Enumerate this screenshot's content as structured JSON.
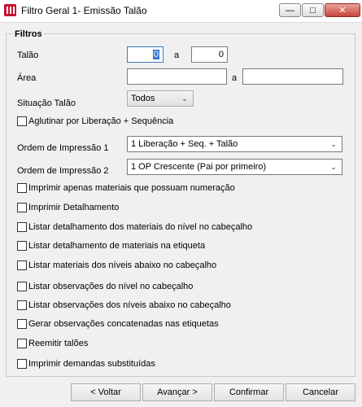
{
  "window": {
    "title": "Filtro Geral 1- Emissão Talão",
    "minimize": "—",
    "maximize": "□",
    "close": "✕"
  },
  "group_title": "Filtros",
  "talao": {
    "label": "Talão",
    "from_value": "0",
    "sep": "a",
    "to_value": "0"
  },
  "area": {
    "label": "Área",
    "from_value": "",
    "sep": "a",
    "to_value": ""
  },
  "situacao": {
    "label": "Situação Talão",
    "value": "Todos"
  },
  "aglutinar": {
    "label": "Aglutinar por Liberação + Sequência",
    "checked": false
  },
  "ordem1": {
    "label": "Ordem de Impressão 1",
    "value": "1 Liberação + Seq. + Talão"
  },
  "ordem2": {
    "label": "Ordem de Impressão 2",
    "value": "1 OP Crescente (Pai por primeiro)"
  },
  "options": [
    {
      "label": "Imprimir apenas materiais que possuam numeração",
      "checked": false
    },
    {
      "label": "Imprimir Detalhamento",
      "checked": false
    },
    {
      "label": "Listar detalhamento dos materiais do nível no cabeçalho",
      "checked": false
    },
    {
      "label": "Listar detalhamento de materiais na etiqueta",
      "checked": false
    },
    {
      "label": "Listar materiais dos níveis abaixo no cabeçalho",
      "checked": false
    },
    {
      "label": "Listar observações do nível no cabeçalho",
      "checked": false
    },
    {
      "label": "Listar observações dos níveis abaixo no cabeçalho",
      "checked": false
    },
    {
      "label": "Gerar observações concatenadas nas etiquetas",
      "checked": false
    },
    {
      "label": "Reemitir talões",
      "checked": false
    },
    {
      "label": "Imprimir demandas substituídas",
      "checked": false
    }
  ],
  "buttons": {
    "back": "< Voltar",
    "next": "Avançar >",
    "confirm": "Confirmar",
    "cancel": "Cancelar"
  },
  "colors": {
    "accent": "#3a77cf",
    "brand": "#c8102e"
  }
}
